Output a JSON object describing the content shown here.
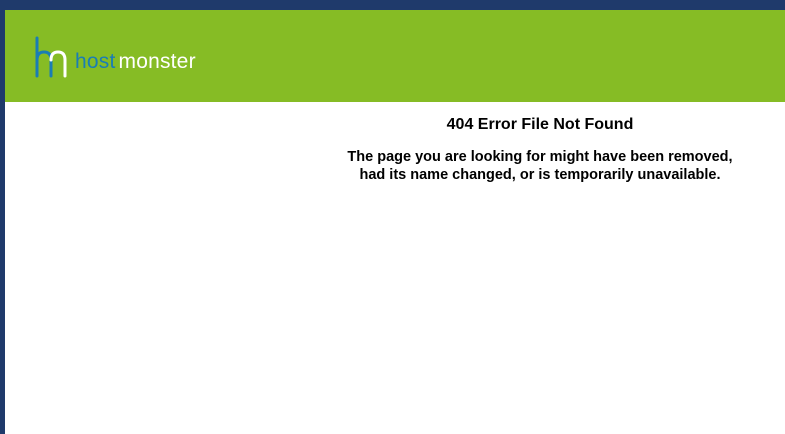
{
  "brand": {
    "name_part1": "host",
    "name_part2": "monster",
    "logo_icon": "hm-monogram-icon",
    "colors": {
      "header": "#86bc25",
      "host_text": "#1a7db5",
      "monster_text": "#ffffff",
      "frame_border": "#1f3a6b"
    }
  },
  "error": {
    "title": "404 Error File Not Found",
    "message_line1": "The page you are looking for might have been removed,",
    "message_line2": "had its name changed, or is temporarily unavailable."
  }
}
